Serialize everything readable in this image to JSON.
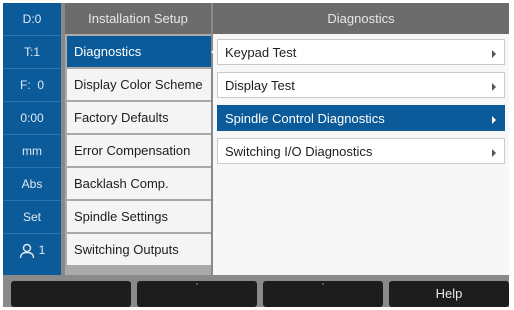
{
  "status_bar": {
    "datum": "D:0",
    "tool": "T:1",
    "feed": "F:  0",
    "timer": "0:00",
    "units": "mm",
    "mode": "Abs",
    "set_label": "Set",
    "user_number": "1",
    "user_icon": "person-icon"
  },
  "left_menu": {
    "title": "Installation Setup",
    "items": [
      {
        "label": "Diagnostics",
        "active": true
      },
      {
        "label": "Display Color Scheme"
      },
      {
        "label": "Factory Defaults"
      },
      {
        "label": "Error Compensation"
      },
      {
        "label": "Backlash Comp."
      },
      {
        "label": "Spindle Settings"
      },
      {
        "label": "Switching Outputs"
      }
    ]
  },
  "right_panel": {
    "title": "Diagnostics",
    "items": [
      {
        "label": "Keypad Test"
      },
      {
        "label": "Display Test"
      },
      {
        "label": "Spindle Control Diagnostics",
        "selected": true
      },
      {
        "label": "Switching I/O Diagnostics"
      }
    ]
  },
  "softkeys": [
    "",
    "",
    "",
    "Help"
  ],
  "colors": {
    "accent": "#0b5a99",
    "header": "#6c6c6c",
    "softkey": "#1d1d1d"
  }
}
